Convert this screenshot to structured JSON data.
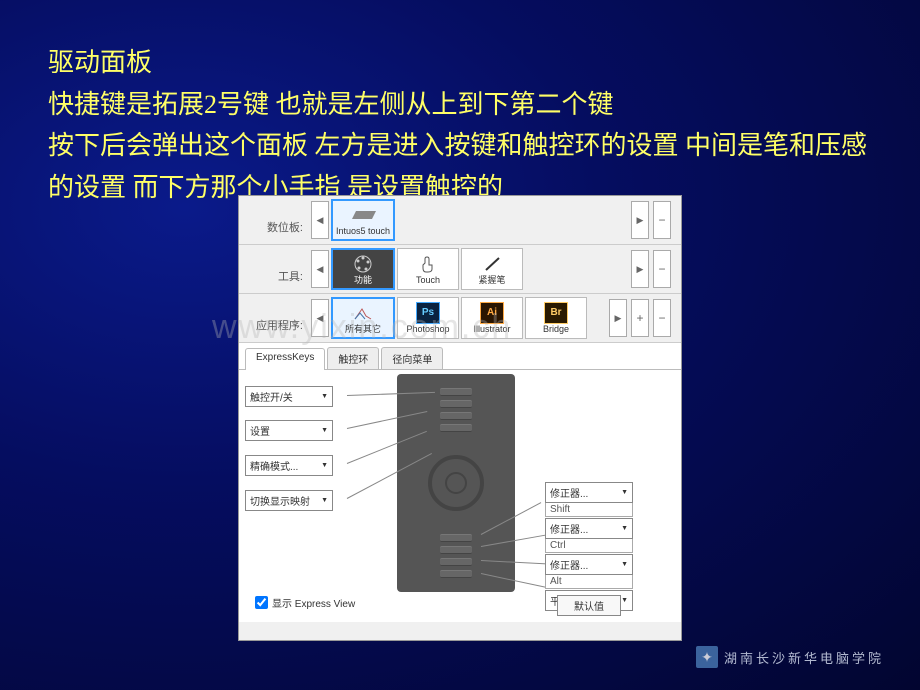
{
  "slide": {
    "line1": "驱动面板",
    "line2": "快捷键是拓展2号键  也就是左侧从上到下第二个键",
    "line3": "按下后会弹出这个面板  左方是进入按键和触控环的设置  中间是笔和压感的设置  而下方那个小手指  是设置触控的"
  },
  "labels": {
    "tablet": "数位板:",
    "tool": "工具:",
    "app": "应用程序:"
  },
  "row_tablet": {
    "item1": "Intuos5 touch"
  },
  "row_tool": {
    "item1": "功能",
    "item2": "Touch",
    "item3": "紧握笔"
  },
  "row_app": {
    "item1": "所有其它",
    "item2": "Photoshop",
    "item3": "Illustrator",
    "item4": "Bridge"
  },
  "tabs": {
    "t1": "ExpressKeys",
    "t2": "触控环",
    "t3": "径向菜单"
  },
  "combos": {
    "left1": "触控开/关",
    "left2": "设置",
    "left3": "精确模式...",
    "left4": "切换显示映射",
    "r_label": "修正器...",
    "r1_sub": "Shift",
    "r2_sub": "Ctrl",
    "r3_sub": "Alt",
    "r4_label": "平移/卷动..."
  },
  "checkbox": "显示 Express View",
  "default_btn": "默认值",
  "watermark": "www.yixin.com.ch",
  "logo_text": "湖南长沙新华电脑学院"
}
